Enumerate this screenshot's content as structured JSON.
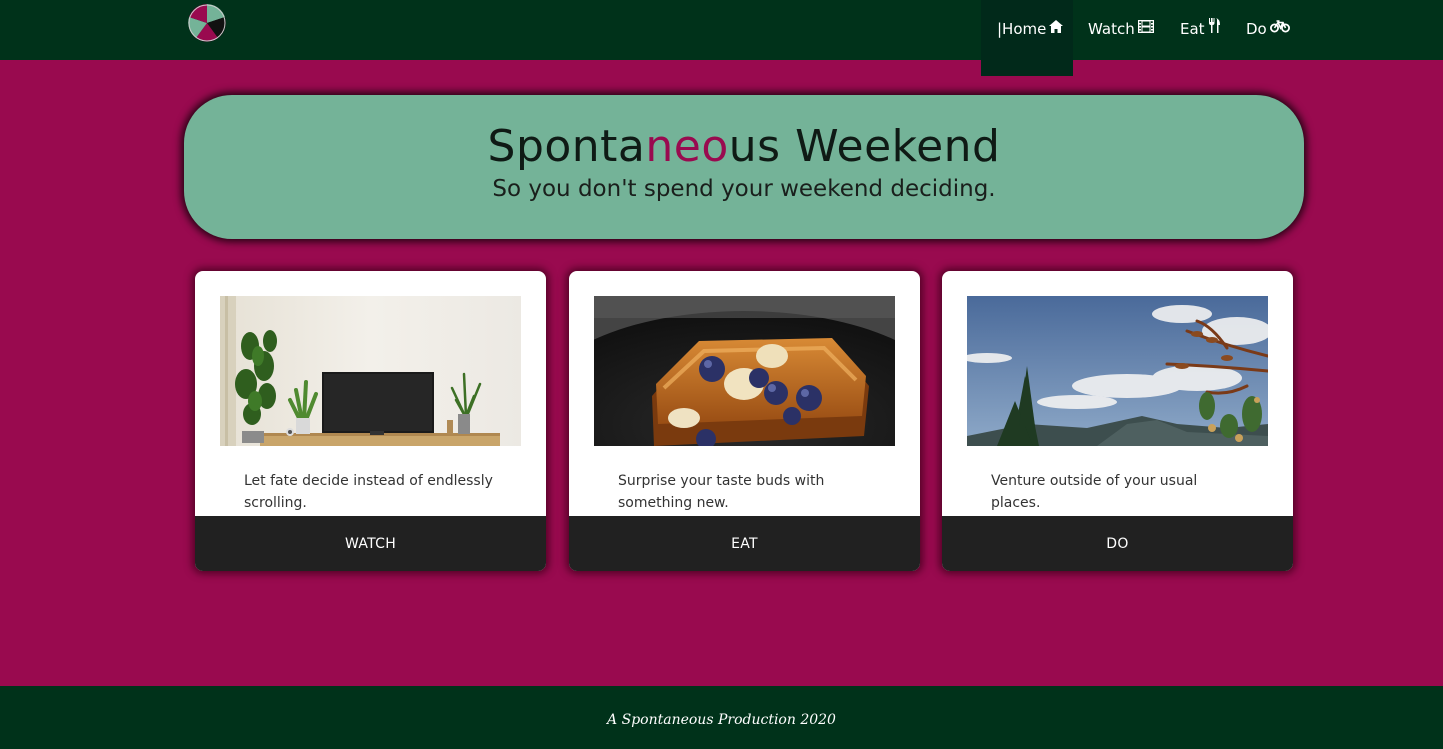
{
  "nav": {
    "logo_icon": "spinner-wheel-logo",
    "items": [
      {
        "label": "|Home",
        "icon": "home-icon"
      },
      {
        "label": "Watch",
        "icon": "film-icon"
      },
      {
        "label": "Eat",
        "icon": "utensils-icon"
      },
      {
        "label": "Do",
        "icon": "bicycle-icon"
      }
    ]
  },
  "hero": {
    "title_pre": "Sponta",
    "title_accent": "neo",
    "title_post": "us Weekend",
    "subtitle": "So you don't spend your weekend deciding."
  },
  "cards": [
    {
      "image": "living-room-tv-plants",
      "text": "Let fate decide instead of endlessly scrolling.",
      "button": "WATCH"
    },
    {
      "image": "french-toast-blueberries",
      "text": "Surprise your taste buds with something new.",
      "button": "EAT"
    },
    {
      "image": "sky-mountains-trees",
      "text": "Venture outside of your usual places.",
      "button": "DO"
    }
  ],
  "footer": {
    "text": "A Spontaneous Production 2020"
  },
  "colors": {
    "page_bg": "#990a4f",
    "nav_bg": "#00321a",
    "hero_bg": "#74b398",
    "card_button_bg": "#212121"
  }
}
